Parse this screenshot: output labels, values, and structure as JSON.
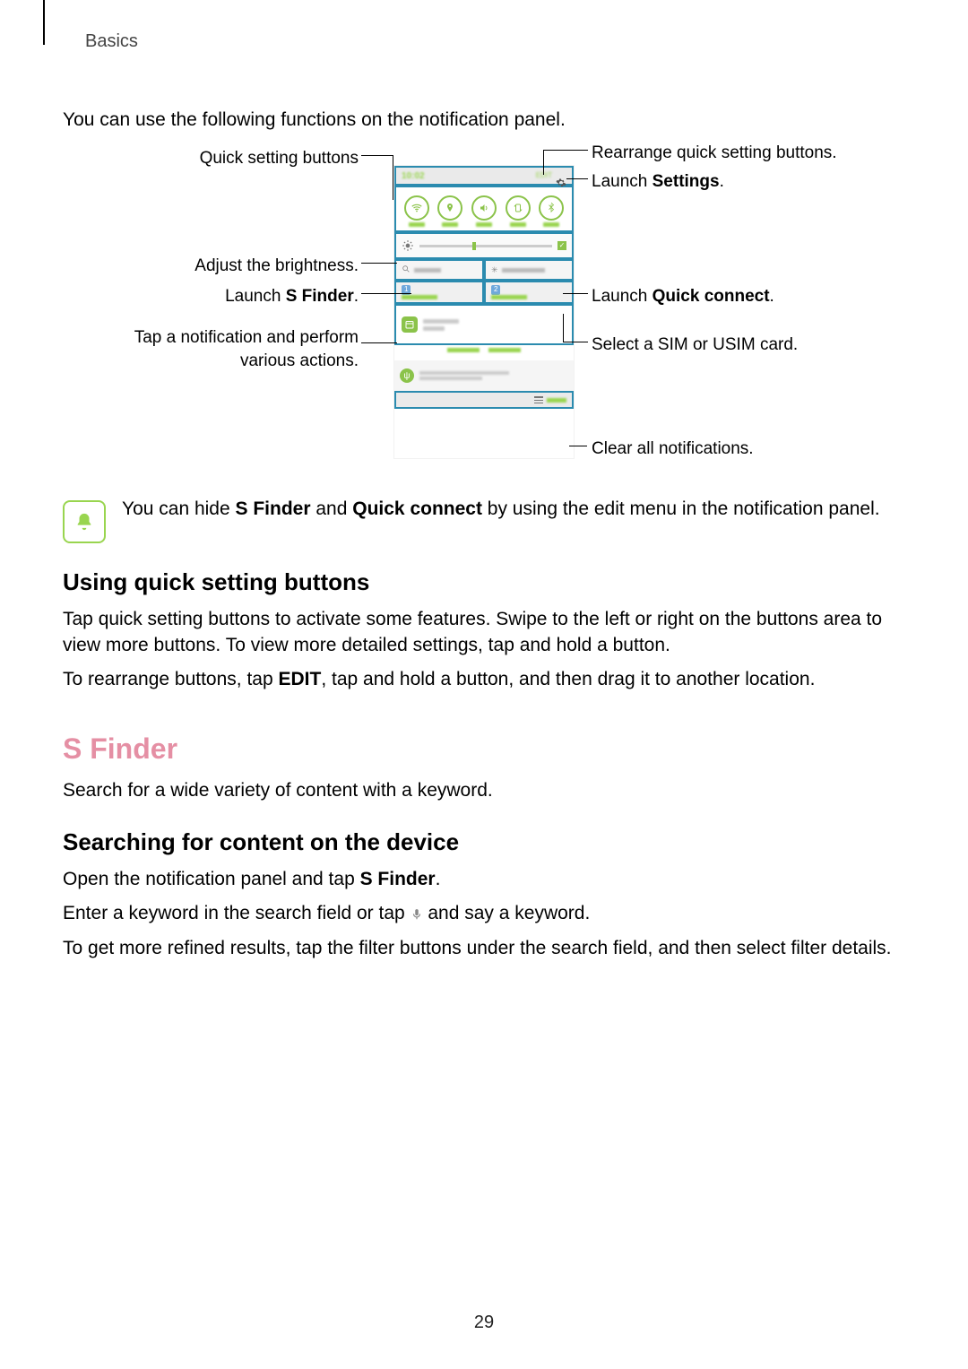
{
  "breadcrumb": "Basics",
  "page_number": "29",
  "intro": "You can use the following functions on the notification panel.",
  "figure": {
    "left": {
      "quick_buttons": "Quick setting buttons",
      "brightness": "Adjust the brightness.",
      "sfinder_parts": {
        "pre": "Launch ",
        "bold": "S Finder",
        "post": "."
      },
      "notif": "Tap a notification and perform various actions."
    },
    "right": {
      "rearrange": "Rearrange quick setting buttons.",
      "settings_parts": {
        "pre": "Launch ",
        "bold": "Settings",
        "post": "."
      },
      "quickconnect_parts": {
        "pre": "Launch ",
        "bold": "Quick connect",
        "post": "."
      },
      "sim": "Select a SIM or USIM card.",
      "clear": "Clear all notifications."
    }
  },
  "tip_parts": {
    "pre": "You can hide ",
    "b1": "S Finder",
    "mid1": " and ",
    "b2": "Quick connect",
    "post": " by using the edit menu in the notification panel."
  },
  "sect1": {
    "title": "Using quick setting buttons",
    "p1": "Tap quick setting buttons to activate some features. Swipe to the left or right on the buttons area to view more buttons. To view more detailed settings, tap and hold a button.",
    "p2_parts": {
      "pre": "To rearrange buttons, tap ",
      "bold": "EDIT",
      "post": ", tap and hold a button, and then drag it to another location."
    }
  },
  "sect2": {
    "title": "S Finder",
    "p1": "Search for a wide variety of content with a keyword."
  },
  "sect3": {
    "title": "Searching for content on the device",
    "p1_parts": {
      "pre": "Open the notification panel and tap ",
      "bold": "S Finder",
      "post": "."
    },
    "p2_parts": {
      "pre": "Enter a keyword in the search field or tap ",
      "post": " and say a keyword."
    },
    "p3": "To get more refined results, tap the filter buttons under the search field, and then select filter details."
  }
}
